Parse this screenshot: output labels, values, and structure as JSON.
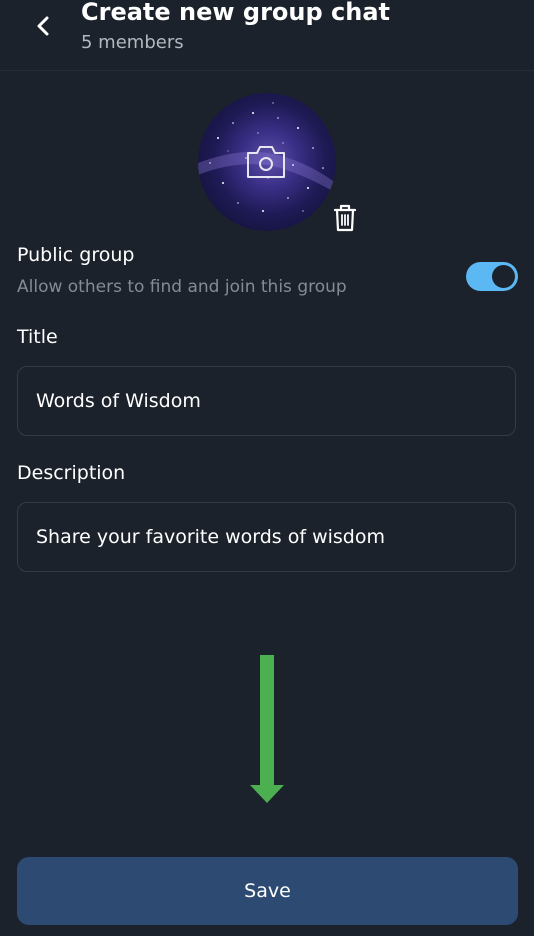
{
  "header": {
    "title": "Create new group chat",
    "subtitle": "5 members"
  },
  "avatar": {
    "camera_icon": "camera-icon",
    "delete_icon": "trash-icon"
  },
  "public_group": {
    "label": "Public group",
    "description": "Allow others to find and join this group",
    "enabled": true,
    "toggle_color": "#5bb8f2"
  },
  "title_field": {
    "label": "Title",
    "value": "Words of Wisdom"
  },
  "description_field": {
    "label": "Description",
    "value": "Share your favorite words of wisdom"
  },
  "annotation": {
    "arrow_color": "#4caf50"
  },
  "save_button": {
    "label": "Save",
    "color": "#2d4b72"
  }
}
